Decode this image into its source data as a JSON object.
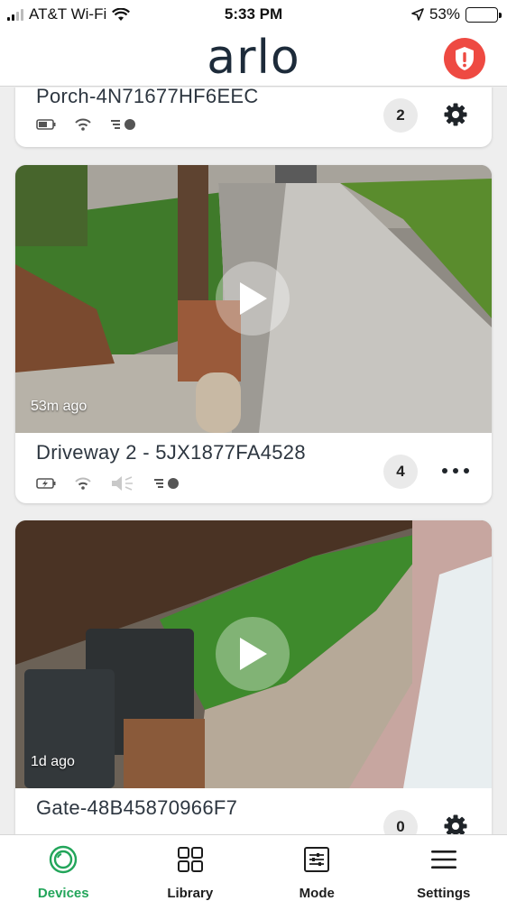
{
  "status_bar": {
    "carrier": "AT&T Wi-Fi",
    "time": "5:33 PM",
    "battery_percent": "53%",
    "battery_level": 0.53
  },
  "header": {
    "logo_text": "arlo",
    "alert_icon": "shield-exclamation-icon",
    "alert_color": "#ee4a42"
  },
  "devices": [
    {
      "name": "Porch-4N71677HF6EEC",
      "count": "2",
      "action_icon": "gear-icon",
      "status_icons": [
        "battery-icon",
        "wifi-icon",
        "motion-icon"
      ]
    },
    {
      "name": "Driveway 2 - 5JX1877FA4528",
      "count": "4",
      "action_icon": "more-icon",
      "time_ago": "53m ago",
      "status_icons": [
        "battery-charging-icon",
        "wifi-icon",
        "speaker-muted-icon",
        "motion-icon"
      ]
    },
    {
      "name": "Gate-48B45870966F7",
      "count": "0",
      "action_icon": "gear-icon",
      "time_ago": "1d ago",
      "status_icons": [
        "battery-icon",
        "wifi-icon",
        "motion-icon"
      ]
    }
  ],
  "nav": {
    "items": [
      {
        "label": "Devices",
        "icon": "devices-icon",
        "active": true
      },
      {
        "label": "Library",
        "icon": "library-grid-icon",
        "active": false
      },
      {
        "label": "Mode",
        "icon": "mode-sliders-icon",
        "active": false
      },
      {
        "label": "Settings",
        "icon": "menu-icon",
        "active": false
      }
    ],
    "accent_color": "#22a55a"
  }
}
